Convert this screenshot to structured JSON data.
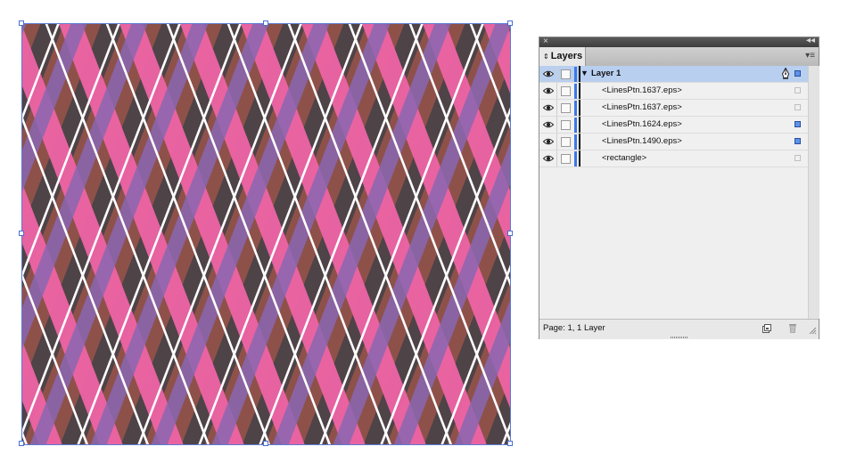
{
  "artwork": {
    "colors": {
      "base": "#8e5149",
      "dark_band": "#4b4248",
      "pink_band": "#ee64a6",
      "purple_band": "#8a66b2",
      "white_line": "#ffffff",
      "selection": "#4a6fd1"
    }
  },
  "panel": {
    "tab_label": "Layers",
    "close_glyph": "×",
    "collapse_glyph": "◂◂",
    "menu_glyph": "▾≡",
    "rows": [
      {
        "label": "Layer 1",
        "kind": "layer",
        "selected": true,
        "visible": true,
        "locked": false,
        "has_selection": true,
        "target_icon": "pen-icon"
      },
      {
        "label": "<LinesPtn.1637.eps>",
        "kind": "item",
        "selected": false,
        "visible": true,
        "locked": false,
        "has_selection": false
      },
      {
        "label": "<LinesPtn.1637.eps>",
        "kind": "item",
        "selected": false,
        "visible": true,
        "locked": false,
        "has_selection": false
      },
      {
        "label": "<LinesPtn.1624.eps>",
        "kind": "item",
        "selected": false,
        "visible": true,
        "locked": false,
        "has_selection": true
      },
      {
        "label": "<LinesPtn.1490.eps>",
        "kind": "item",
        "selected": false,
        "visible": true,
        "locked": false,
        "has_selection": true
      },
      {
        "label": "<rectangle>",
        "kind": "item",
        "selected": false,
        "visible": true,
        "locked": false,
        "has_selection": false
      }
    ],
    "status_text": "Page: 1, 1 Layer",
    "layer_color": "#3c78e6",
    "selected_row_color": "#b8cff0"
  }
}
